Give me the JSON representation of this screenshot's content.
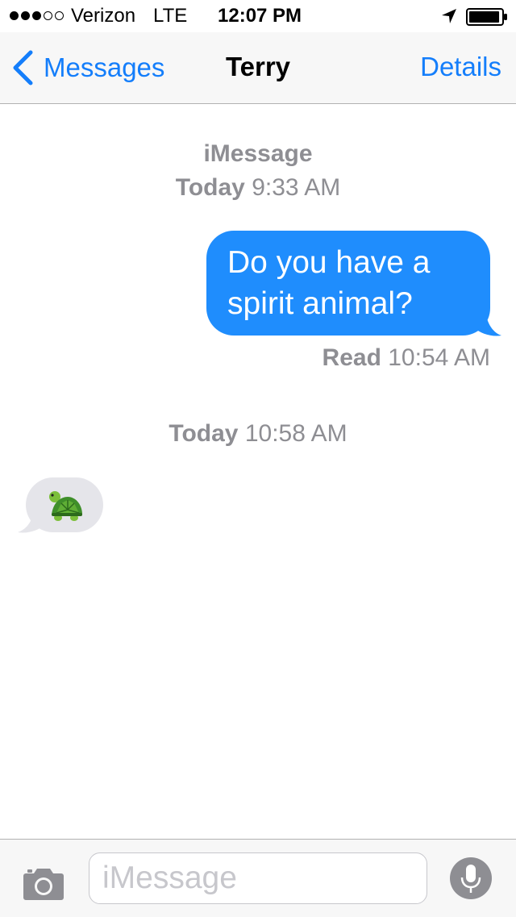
{
  "status_bar": {
    "signal_bars_filled": 3,
    "signal_bars_total": 5,
    "carrier": "Verizon",
    "network": "LTE",
    "time": "12:07 PM",
    "battery_level": 0.95
  },
  "nav": {
    "back_label": "Messages",
    "title": "Terry",
    "details_label": "Details"
  },
  "conversation": {
    "service_label": "iMessage",
    "first_header": {
      "day": "Today",
      "time": "9:33 AM"
    },
    "outgoing_message": {
      "line1": "Do you have a",
      "line2": "spirit animal?",
      "status": "Read",
      "status_time": "10:54 AM"
    },
    "second_header": {
      "day": "Today",
      "time": "10:58 AM"
    },
    "incoming_message": {
      "emoji": "turtle"
    }
  },
  "input_bar": {
    "placeholder": "iMessage"
  },
  "colors": {
    "accent": "#147efb",
    "outgoing_bubble": "#1f8dfd",
    "incoming_bubble": "#e5e5ea",
    "secondary_text": "#8e8e93"
  },
  "icons": [
    "signal-dots",
    "location-arrow-icon",
    "battery-icon",
    "chevron-left-icon",
    "camera-icon",
    "microphone-icon",
    "turtle-emoji"
  ]
}
